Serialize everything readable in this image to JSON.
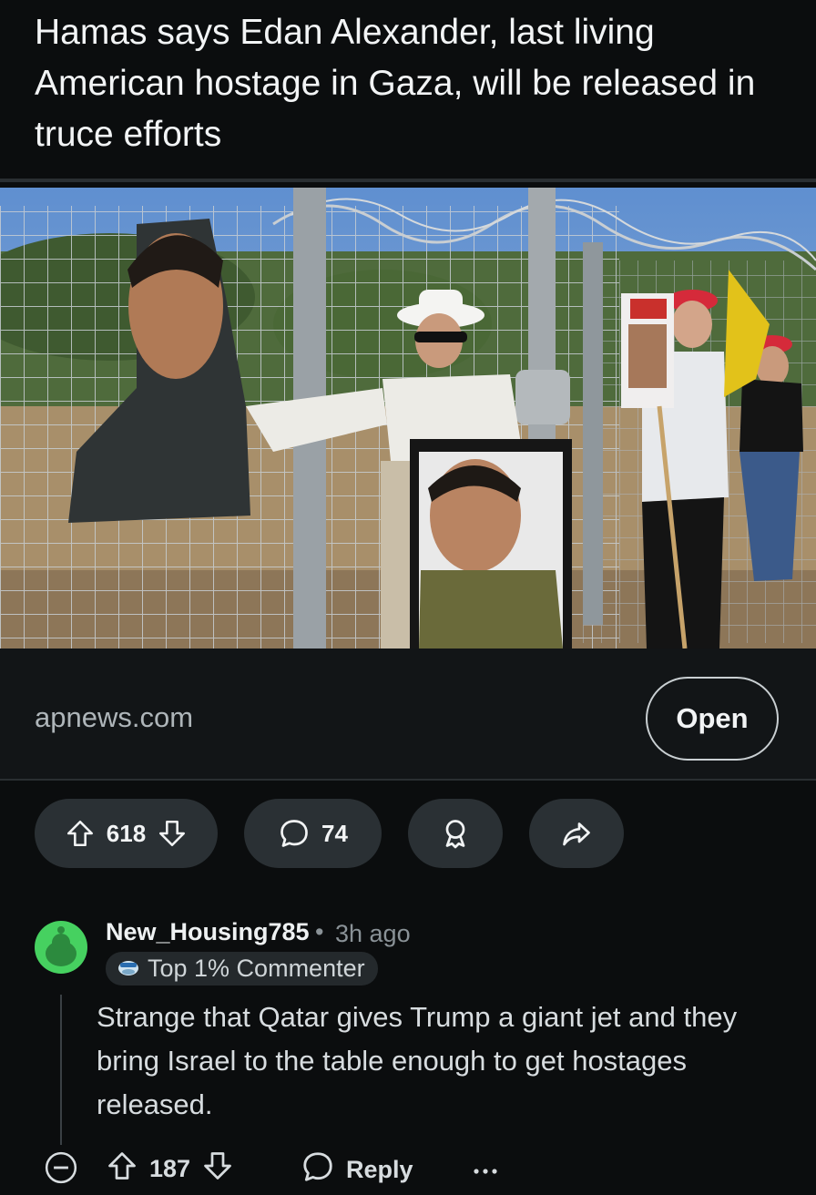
{
  "post": {
    "title": "Hamas says Edan Alexander, last living American hostage in Gaza, will be released in truce efforts",
    "link_domain": "apnews.com",
    "open_label": "Open",
    "upvotes": "618",
    "comments": "74"
  },
  "comment": {
    "username": "New_Housing785",
    "separator": "•",
    "age": "3h ago",
    "badge": "Top 1% Commenter",
    "body": "Strange that Qatar gives Trump a giant jet and they bring Israel to the table enough to get hostages released.",
    "score": "187",
    "reply_label": "Reply"
  },
  "icons": {
    "upvote": "arrow-up-icon",
    "downvote": "arrow-down-icon",
    "comment": "speech-bubble-icon",
    "award": "award-icon",
    "share": "share-arrow-icon",
    "collapse": "minus-circle-icon",
    "more": "ellipsis-icon"
  },
  "colors": {
    "background": "#0b0d0e",
    "pill": "#2a3034",
    "avatar": "#46d160"
  }
}
